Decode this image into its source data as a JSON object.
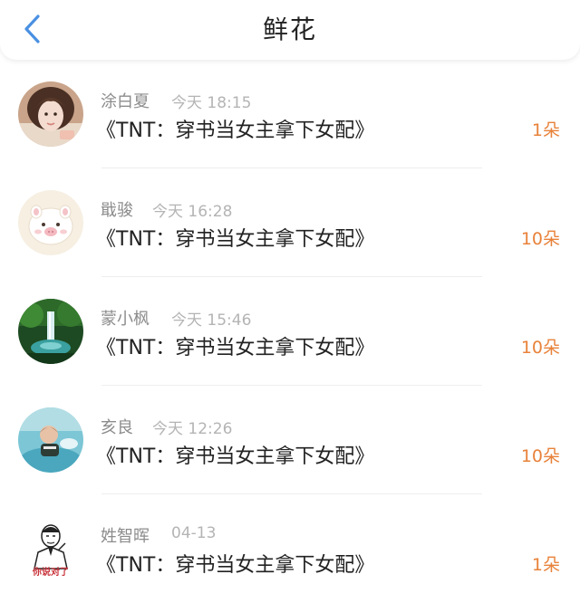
{
  "header": {
    "title": "鲜花",
    "back_icon": "chevron-left-icon",
    "accent_color": "#4a90e2"
  },
  "records": [
    {
      "user": "涂白夏",
      "time": "今天 18:15",
      "book": "《TNT：穿书当女主拿下女配》",
      "count": "1朵"
    },
    {
      "user": "戢骏",
      "time": "今天 16:28",
      "book": "《TNT：穿书当女主拿下女配》",
      "count": "10朵"
    },
    {
      "user": "蒙小枫",
      "time": "今天 15:46",
      "book": "《TNT：穿书当女主拿下女配》",
      "count": "10朵"
    },
    {
      "user": "亥良",
      "time": "今天 12:26",
      "book": "《TNT：穿书当女主拿下女配》",
      "count": "10朵"
    },
    {
      "user": "姓智晖",
      "time": "04-13",
      "book": "《TNT：穿书当女主拿下女配》",
      "count": "1朵",
      "avatar_caption": "你说对了"
    }
  ],
  "colors": {
    "count": "#e8823a",
    "name": "#8c8c8c",
    "time": "#b4b4b4"
  }
}
